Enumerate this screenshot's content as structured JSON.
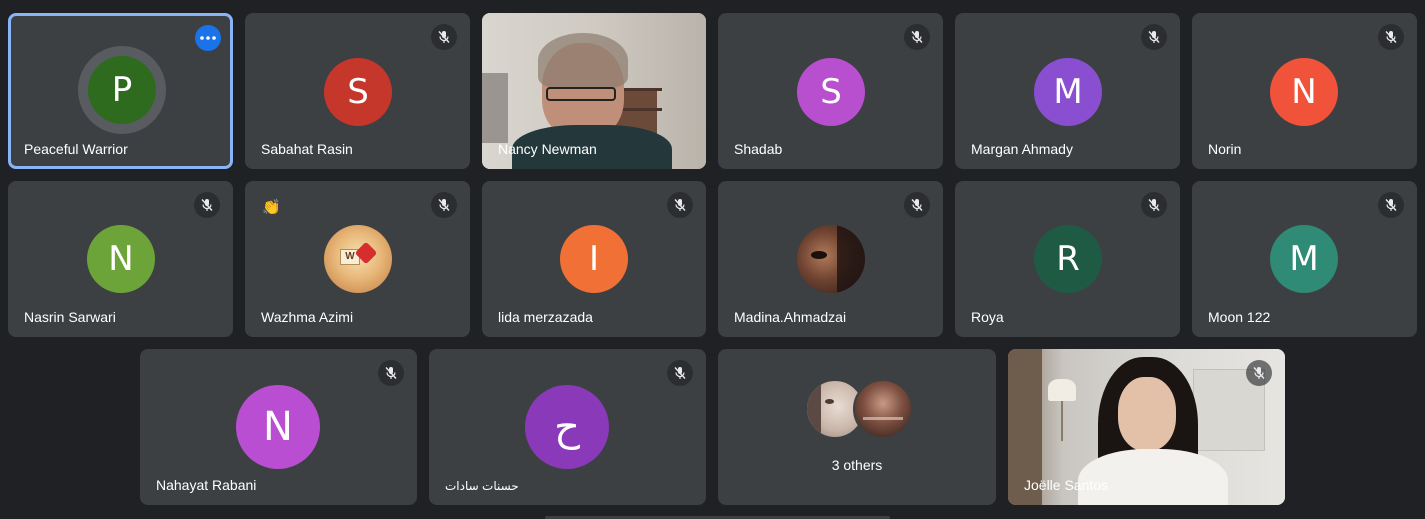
{
  "tiles": [
    {
      "name": "Peaceful Warrior",
      "initial": "P"
    },
    {
      "name": "Sabahat Rasin",
      "initial": "S"
    },
    {
      "name": "Nancy Newman"
    },
    {
      "name": "Shadab",
      "initial": "S"
    },
    {
      "name": "Margan Ahmady",
      "initial": "M"
    },
    {
      "name": "Norin",
      "initial": "N"
    },
    {
      "name": "Nasrin Sarwari",
      "initial": "N"
    },
    {
      "name": "Wazhma Azimi",
      "avatar_text": "W"
    },
    {
      "name": "lida merzazada",
      "initial": "I"
    },
    {
      "name": "Madina.Ahmadzai"
    },
    {
      "name": "Roya",
      "initial": "R"
    },
    {
      "name": "Moon 122",
      "initial": "M"
    },
    {
      "name": "Nahayat Rabani",
      "initial": "N"
    },
    {
      "name": "حسنات سادات",
      "initial": "ح"
    },
    {
      "label": "3 others"
    },
    {
      "name": "Joëlle Santos"
    }
  ],
  "colors": {
    "background": "#202124",
    "tile": "#3c4043",
    "active_border": "#8ab4f8",
    "more_button": "#1a73e8",
    "avatar_peaceful_warrior": "#2e6b1e",
    "avatar_sabahat": "#c5362b",
    "avatar_shadab": "#b84fcf",
    "avatar_margan": "#8a4fd0",
    "avatar_norin": "#f0523a",
    "avatar_nasrin": "#6da43a",
    "avatar_lida": "#f07035",
    "avatar_roya": "#1f5a45",
    "avatar_moon": "#2f8a76",
    "avatar_nahayat": "#b94ed2",
    "avatar_hasanat": "#8a39b8"
  },
  "icons": [
    "more-options-icon",
    "mic-off-icon",
    "raised-hand-icon"
  ]
}
